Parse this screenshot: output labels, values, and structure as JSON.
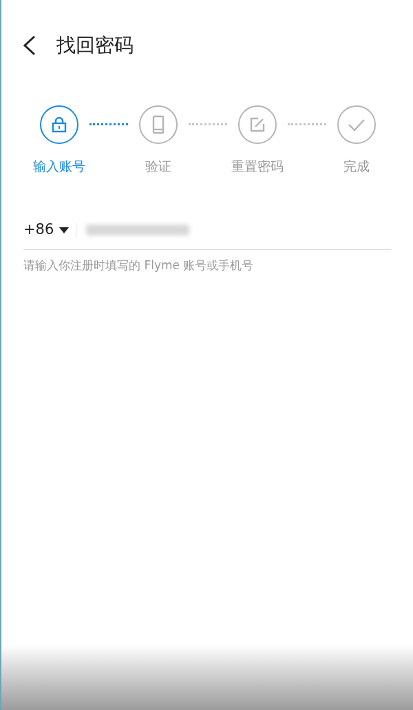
{
  "header": {
    "title": "找回密码"
  },
  "steps": [
    {
      "label": "输入账号",
      "selected": true
    },
    {
      "label": "验证",
      "selected": false
    },
    {
      "label": "重置密码",
      "selected": false
    },
    {
      "label": "完成",
      "selected": false
    }
  ],
  "phone_field": {
    "country_code": "+86",
    "hint": "请输入你注册时填写的 Flyme 账号或手机号"
  }
}
